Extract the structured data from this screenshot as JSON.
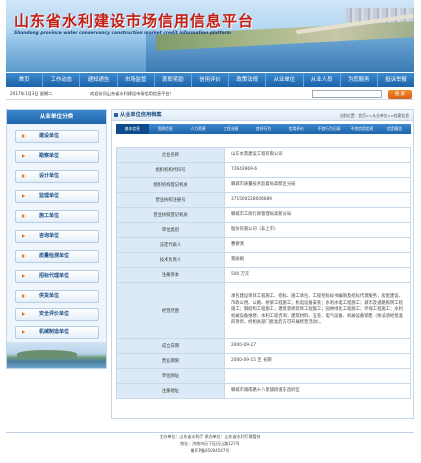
{
  "banner": {
    "title": "山东省水利建设市场信用信息平台",
    "subtitle": "Shandong province water conservancy construction market credit information platform"
  },
  "nav": [
    "首页",
    "工作动态",
    "通知通告",
    "市场监管",
    "表彰奖励",
    "信用评价",
    "政策法规",
    "从业单位",
    "从业人员",
    "为您服务",
    "投诉举报"
  ],
  "infobar": {
    "date": "2017年1月3日  星期二",
    "notice": "欢迎访问山东省水利建设市场信用信息平台！",
    "search_placeholder": "",
    "search_button": "搜 索"
  },
  "sidebar": {
    "header": "从业单位分类",
    "items": [
      "建设单位",
      "勘察单位",
      "设计单位",
      "监理单位",
      "施工单位",
      "咨询单位",
      "质量检测单位",
      "招标代理单位",
      "供货单位",
      "安全评价单位",
      "机械制造单位"
    ]
  },
  "main": {
    "title": "从业单位信用档案",
    "breadcrumb": "当前位置：首页>>从业单位>>档案信息",
    "tabs": [
      "基本信息",
      "资质信息",
      "人力资源",
      "工程业绩",
      "良好行为",
      "信用评价",
      "不良行为记录",
      "不良信用信息",
      "信用报告"
    ],
    "rows": [
      {
        "label": "企业名称",
        "value": "山东水景建设工程有限公司"
      },
      {
        "label": "组织机构代码号",
        "value": "72643969-6"
      },
      {
        "label": "组织机构登记机关",
        "value": "聊城市质量技术监督局高新区分局"
      },
      {
        "label": "营业执照注册号",
        "value": "371500228006689"
      },
      {
        "label": "营业执照登记机关",
        "value": "聊城市工商行政管理局高新分局"
      },
      {
        "label": "单位类别",
        "value": "股份有限公司（非上市）"
      },
      {
        "label": "法定代表人",
        "value": "曹德清"
      },
      {
        "label": "技术负责人",
        "value": "蒋丽娟"
      },
      {
        "label": "注册资本",
        "value": "500 万元"
      },
      {
        "label": "经营范围",
        "value": "承包建设项目工程施工、招标、施工承包、工程招标标书编制及招标代理服务；房屋建设、市政公用、公路、桥梁工程施工；机电设备安装；水利水电工程施工；城市及道路照明工程施工；钢结构工程施工；建筑装修装饰工程施工；园林绿化工程施工；环保工程施工；水利机械设备维修；水利工程咨询；建筑材料、五金、电气设备、机械设备销售（依法须经批准的项目，经相关部门批准后方可开展经营活动）。"
      },
      {
        "label": "成立日期",
        "value": "2000-09-27"
      },
      {
        "label": "营业期限",
        "value": "2000-09-15  至  长期"
      },
      {
        "label": "单位网址",
        "value": ""
      },
      {
        "label": "注册地址",
        "value": "聊城市湖南路十八里铺街道东昌府区"
      }
    ]
  },
  "footer": {
    "line1": "主办单位：山东省水利厅   承办单位：山东省水利厅建管处",
    "line2": "地址：济南市历下区历山路127号",
    "line3": "鲁ICP备05004547号"
  }
}
